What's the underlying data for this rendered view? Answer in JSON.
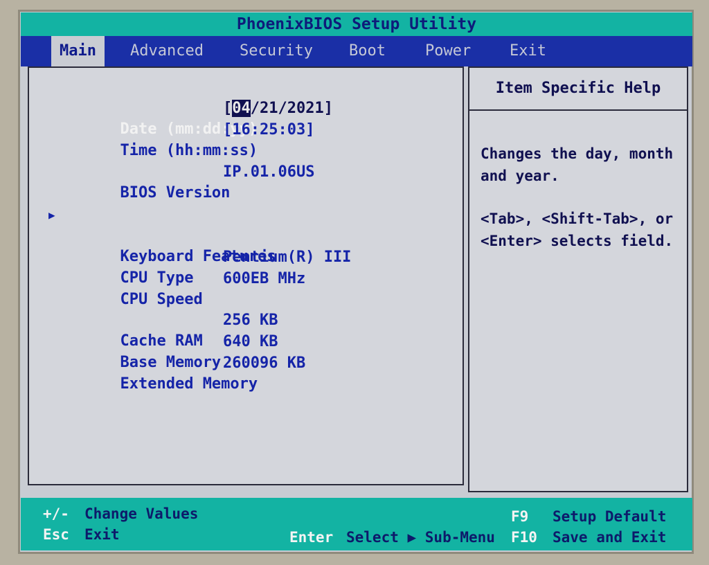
{
  "title": "PhoenixBIOS Setup Utility",
  "menu": [
    {
      "label": "Main",
      "active": true
    },
    {
      "label": "Advanced"
    },
    {
      "label": "Security"
    },
    {
      "label": "Boot"
    },
    {
      "label": "Power"
    },
    {
      "label": "Exit"
    }
  ],
  "fields": {
    "date": {
      "label": "Date (mm:dd:yy)",
      "open": "[",
      "month": "04",
      "rest": "/21/2021]"
    },
    "time": {
      "label": "Time (hh:mm:ss)",
      "value": "[16:25:03]"
    },
    "bios_version": {
      "label": "BIOS Version",
      "value": "IP.01.06US"
    },
    "keyboard": {
      "label": "Keyboard Features"
    },
    "cpu_type": {
      "label": "CPU Type",
      "value": "Pentium(R) III"
    },
    "cpu_speed": {
      "label": "CPU Speed",
      "value": "600EB MHz"
    },
    "cache_ram": {
      "label": "Cache RAM",
      "value": "256 KB"
    },
    "base_memory": {
      "label": "Base Memory",
      "value": "640 KB"
    },
    "extended_memory": {
      "label": "Extended Memory",
      "value": "260096 KB"
    }
  },
  "help": {
    "title": "Item Specific Help",
    "line1": "Changes the day, month",
    "line2": "and year.",
    "line3": "<Tab>, <Shift-Tab>, or",
    "line4": "<Enter> selects field."
  },
  "status": {
    "k1": "+/-",
    "d1": "Change Values",
    "k2": "Esc",
    "d2": "Exit",
    "k3": "Enter",
    "d3": "Select ▶ Sub-Menu",
    "k4": "F9",
    "d4": "Setup Default",
    "k5": "F10",
    "d5": "Save and Exit"
  },
  "colors": {
    "teal": "#13b3a3",
    "menu_blue": "#1a2fa6",
    "panel": "#d4d6dc",
    "text_blue": "#1524a8"
  }
}
